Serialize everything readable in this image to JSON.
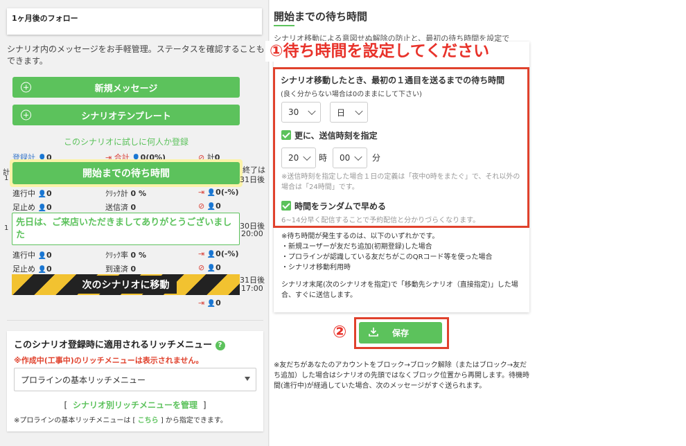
{
  "left": {
    "followup_title": "1ヶ月後のフォロー",
    "desc": "シナリオ内のメッセージをお手軽管理。ステータスを確認することもできます。",
    "new_message_btn": "新規メッセージ",
    "template_btn": "シナリオテンプレート",
    "trial_link": "このシナリオに試しに何人か登録",
    "row1": {
      "registered": "登録計",
      "registered_val": "0",
      "total": "合計",
      "total_val": "0(0%)",
      "count": "計",
      "count_val": "0"
    },
    "wait_button": "開始までの待ち時間",
    "partial_left": "計",
    "partial_left2": "1",
    "end_label": "終了は",
    "end_date": "31日後",
    "row2": {
      "progress": "進行中",
      "progress_val": "0",
      "click_total": "ｸﾘｯｸ計",
      "click_total_val": "0 %",
      "out_val": "0(-%)"
    },
    "row3": {
      "stop": "足止め",
      "stop_val": "0",
      "sent": "送信済",
      "sent_val": "0",
      "block_val": "0"
    },
    "message_text": "先日は、ご来店いただきましてありがとうございました",
    "partial_left3": "1",
    "day30": "30日後",
    "time30": "20:00",
    "row4": {
      "progress": "進行中",
      "progress_val": "0",
      "click_rate": "ｸﾘｯｸ率",
      "click_rate_val": "0 %",
      "out_val": "0(-%)"
    },
    "row5": {
      "stop": "足止め",
      "stop_val": "0",
      "arrived": "到達済",
      "arrived_val": "0",
      "block_val": "0"
    },
    "next_scenario": "次のシナリオに移動",
    "day31": "31日後",
    "time31": "17:00",
    "last_out_val": "0",
    "rich_title": "このシナリオ登録時に適用されるリッチメニュー",
    "rich_warning": "※作成中(工事中)のリッチメニューは表示されません。",
    "rich_select": "プロラインの基本リッチメニュー",
    "rich_manage_open": "[",
    "rich_manage": "シナリオ別リッチメニューを管理",
    "rich_manage_close": "]",
    "rich_note_pre": "※プロラインの基本リッチメニューは [",
    "rich_note_link": "こちら",
    "rich_note_post": "] から指定できます。"
  },
  "right": {
    "title": "開始までの待ち時間",
    "subtitle": "シナリオ移動による意図せぬ解除の防止と、最初の待ち時間を設定で",
    "annotation1": "①待ち時間を設定してください",
    "section_title": "シナリオ移動したとき、最初の１通目を送るまでの待ち時間",
    "hint": "(良く分からない場合は0のままにして下さい)",
    "days_value": "30",
    "unit_value": "日",
    "specify_time_label": "更に、送信時刻を指定",
    "hour_value": "20",
    "hour_unit": "時",
    "minute_value": "00",
    "minute_unit": "分",
    "time_note": "※送信時刻を指定した場合１日の定義は「夜中0時をまたぐ」で、それ以外の場合は「24時間」です。",
    "random_label": "時間をランダムで早める",
    "random_note": "6~14分早く配信することで予約配信と分かりづらくなります。",
    "occur_note": "※待ち時間が発生するのは、以下のいずれかです。",
    "occur_items": [
      "・新規ユーザーが友だち追加(初期登録)した場合",
      "・プロラインが認識している友だちがこのQRコード等を使った場合",
      "・シナリオ移動利用時"
    ],
    "end_note": "シナリオ末尾(次のシナリオを指定)で「移動先シナリオ（直接指定)」した場合、すぐに送信します。",
    "annotation2": "②",
    "save_btn": "保存",
    "block_note": "※友だちがあなたのアカウントをブロック→ブロック解除（またはブロック→友だち追加）した場合はシナリオの先頭ではなくブロック位置から再開します。待機時間(進行中)が経過していた場合、次のメッセージがすぐ送られます。"
  },
  "colors": {
    "green": "#5cc25c",
    "red": "#e0412c",
    "annotation": "#e8322a"
  }
}
